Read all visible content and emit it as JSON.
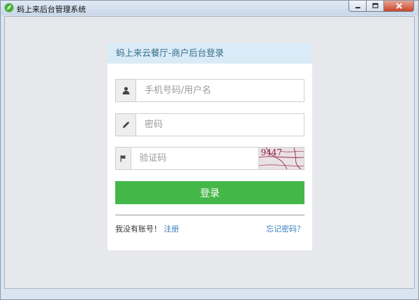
{
  "window": {
    "title": "蚂上来后台管理系统",
    "icon": "leaf-logo-icon",
    "controls": {
      "minimize": "minimize-icon",
      "maximize": "maximize-icon",
      "close": "close-icon"
    }
  },
  "login": {
    "header": "蚂上来云餐厅-商户后台登录",
    "username": {
      "placeholder": "手机号码/用户名",
      "value": "",
      "icon": "user-icon"
    },
    "password": {
      "placeholder": "密码",
      "value": "",
      "icon": "pencil-icon"
    },
    "captcha": {
      "placeholder": "验证码",
      "value": "",
      "icon": "flag-icon",
      "image_text": "9447"
    },
    "submit_label": "登录",
    "no_account_text": "我没有账号！",
    "register_label": "注册",
    "forgot_label": "忘记密码？"
  },
  "colors": {
    "accent_green": "#45b749",
    "header_bg": "#d9ebf6",
    "link_blue": "#3a7fbf"
  }
}
